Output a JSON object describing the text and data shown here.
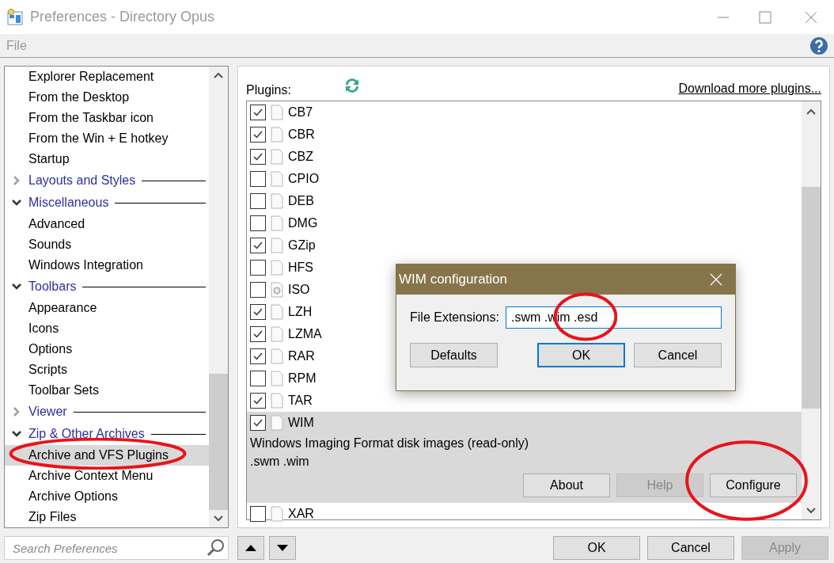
{
  "window": {
    "title": "Preferences - Directory Opus"
  },
  "menu": [
    "File"
  ],
  "tree": [
    {
      "kind": "item",
      "label": "Explorer Replacement",
      "selected": false
    },
    {
      "kind": "item",
      "label": "From the Desktop",
      "selected": false
    },
    {
      "kind": "item",
      "label": "From the Taskbar icon",
      "selected": false
    },
    {
      "kind": "item",
      "label": "From the Win + E hotkey",
      "selected": false
    },
    {
      "kind": "item",
      "label": "Startup",
      "selected": false
    },
    {
      "kind": "group",
      "label": "Layouts and Styles",
      "expanded": false
    },
    {
      "kind": "group",
      "label": "Miscellaneous",
      "expanded": true,
      "children": [
        {
          "kind": "item",
          "label": "Advanced",
          "selected": false
        },
        {
          "kind": "item",
          "label": "Sounds",
          "selected": false
        },
        {
          "kind": "item",
          "label": "Windows Integration",
          "selected": false
        }
      ]
    },
    {
      "kind": "group",
      "label": "Toolbars",
      "expanded": true,
      "children": [
        {
          "kind": "item",
          "label": "Appearance",
          "selected": false
        },
        {
          "kind": "item",
          "label": "Icons",
          "selected": false
        },
        {
          "kind": "item",
          "label": "Options",
          "selected": false
        },
        {
          "kind": "item",
          "label": "Scripts",
          "selected": false
        },
        {
          "kind": "item",
          "label": "Toolbar Sets",
          "selected": false
        }
      ]
    },
    {
      "kind": "group",
      "label": "Viewer",
      "expanded": false
    },
    {
      "kind": "group",
      "label": "Zip & Other Archives",
      "expanded": true,
      "children": [
        {
          "kind": "item",
          "label": "Archive and VFS Plugins",
          "selected": true
        },
        {
          "kind": "item",
          "label": "Archive Context Menu",
          "selected": false
        },
        {
          "kind": "item",
          "label": "Archive Options",
          "selected": false
        },
        {
          "kind": "item",
          "label": "Zip Files",
          "selected": false
        }
      ]
    }
  ],
  "search": {
    "placeholder": "Search Preferences"
  },
  "plugins_label": "Plugins:",
  "download_link": "Download more plugins...",
  "plugins": [
    {
      "name": "CB7",
      "checked": true,
      "kind": "file",
      "selected": false
    },
    {
      "name": "CBR",
      "checked": true,
      "kind": "file",
      "selected": false
    },
    {
      "name": "CBZ",
      "checked": true,
      "kind": "file",
      "selected": false
    },
    {
      "name": "CPIO",
      "checked": false,
      "kind": "file",
      "selected": false
    },
    {
      "name": "DEB",
      "checked": false,
      "kind": "file",
      "selected": false
    },
    {
      "name": "DMG",
      "checked": false,
      "kind": "file",
      "selected": false
    },
    {
      "name": "GZip",
      "checked": true,
      "kind": "file",
      "selected": false
    },
    {
      "name": "HFS",
      "checked": false,
      "kind": "file",
      "selected": false
    },
    {
      "name": "ISO",
      "checked": false,
      "kind": "disc",
      "selected": false
    },
    {
      "name": "LZH",
      "checked": true,
      "kind": "file",
      "selected": false
    },
    {
      "name": "LZMA",
      "checked": true,
      "kind": "file",
      "selected": false
    },
    {
      "name": "RAR",
      "checked": true,
      "kind": "file",
      "selected": false
    },
    {
      "name": "RPM",
      "checked": false,
      "kind": "file",
      "selected": false
    },
    {
      "name": "TAR",
      "checked": true,
      "kind": "file",
      "selected": false
    },
    {
      "name": "WIM",
      "checked": true,
      "kind": "file",
      "selected": true,
      "description": "Windows Imaging Format disk images (read-only)",
      "extensions": ".swm .wim",
      "buttons": [
        {
          "label": "About",
          "disabled": false
        },
        {
          "label": "Help",
          "disabled": true
        },
        {
          "label": "Configure",
          "disabled": false
        }
      ]
    },
    {
      "name": "XAR",
      "checked": false,
      "kind": "file",
      "selected": false
    }
  ],
  "dialog": {
    "title": "WIM configuration",
    "field_label": "File Extensions:",
    "field_value": ".swm .wim .esd",
    "buttons": [
      {
        "label": "Defaults",
        "default": false
      },
      {
        "label": "OK",
        "default": true
      },
      {
        "label": "Cancel",
        "default": false
      }
    ]
  },
  "footer_buttons": [
    {
      "label": "OK",
      "disabled": false
    },
    {
      "label": "Cancel",
      "disabled": false
    },
    {
      "label": "Apply",
      "disabled": true
    }
  ]
}
